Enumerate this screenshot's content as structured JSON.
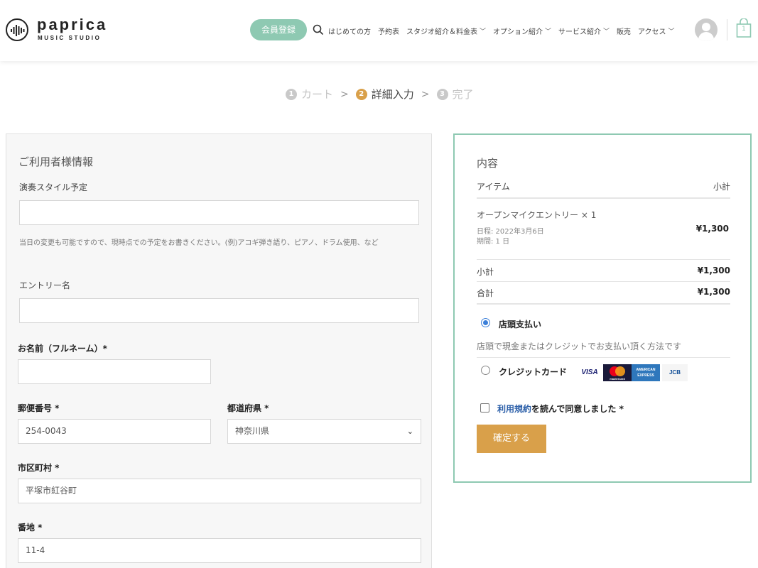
{
  "header": {
    "logo_name": "paprica",
    "logo_sub": "MUSIC STUDIO",
    "member_button": "会員登録",
    "nav": [
      {
        "label": "はじめての方",
        "dropdown": false
      },
      {
        "label": "予約表",
        "dropdown": false
      },
      {
        "label": "スタジオ紹介＆料金表",
        "dropdown": true
      },
      {
        "label": "オプション紹介",
        "dropdown": true
      },
      {
        "label": "サービス紹介",
        "dropdown": true
      },
      {
        "label": "販売",
        "dropdown": false
      },
      {
        "label": "アクセス",
        "dropdown": true
      }
    ],
    "cart_count": "1"
  },
  "steps": [
    {
      "num": "1",
      "label": "カート"
    },
    {
      "num": "2",
      "label": "詳細入力"
    },
    {
      "num": "3",
      "label": "完了"
    }
  ],
  "form": {
    "title": "ご利用者様情報",
    "style_label": "演奏スタイル予定",
    "style_value": "",
    "style_help": "当日の変更も可能ですので、現時点での予定をお書きください。(例)アコギ弾き語り、ピアノ、ドラム使用、など",
    "entry_label": "エントリー名",
    "entry_value": "",
    "name_label": "お名前（フルネーム）*",
    "name_value": "",
    "zip_label": "郵便番号 *",
    "zip_value": "254-0043",
    "pref_label": "都道府県 *",
    "pref_value": "神奈川県",
    "city_label": "市区町村 *",
    "city_value": "平塚市紅谷町",
    "addr_label": "番地 *",
    "addr_value": "11-4"
  },
  "order": {
    "title": "内容",
    "col_item": "アイテム",
    "col_subtotal": "小計",
    "item_name": "オープンマイクエントリー  × 1",
    "item_date": "日程: 2022年3月6日",
    "item_period": "期間: 1 日",
    "item_price": "¥1,300",
    "subtotal_label": "小計",
    "subtotal_value": "¥1,300",
    "total_label": "合計",
    "total_value": "¥1,300",
    "pay_store_label": "店頭支払い",
    "pay_store_desc": "店頭で現金またはクレジットでお支払い頂く方法です",
    "pay_credit_label": "クレジットカード",
    "cards": [
      "VISA",
      "mastercard",
      "AMERICAN EXPRESS",
      "JCB"
    ],
    "terms_link": "利用規約",
    "terms_text": "を読んで同意しました *",
    "confirm_button": "確定する"
  },
  "colors": {
    "accent_green": "#8ec9b2",
    "accent_gold": "#d9a04a",
    "link_blue": "#2a5ea8"
  }
}
